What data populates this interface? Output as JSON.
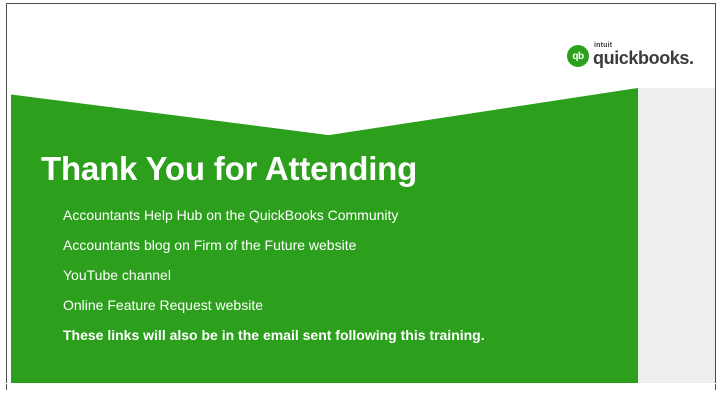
{
  "logo": {
    "mark": "qb",
    "small_text": "intuit",
    "wordmark": "quickbooks."
  },
  "slide": {
    "title": "Thank You for Attending",
    "items": [
      "Accountants Help Hub on the QuickBooks Community",
      "Accountants blog on Firm of the Future website",
      "YouTube channel",
      "Online Feature Request website"
    ],
    "note": "These links will also be in the email sent following this training."
  },
  "colors": {
    "brand_green": "#2ca01c",
    "side_panel": "#eceeef",
    "text_on_green": "#ffffff"
  }
}
